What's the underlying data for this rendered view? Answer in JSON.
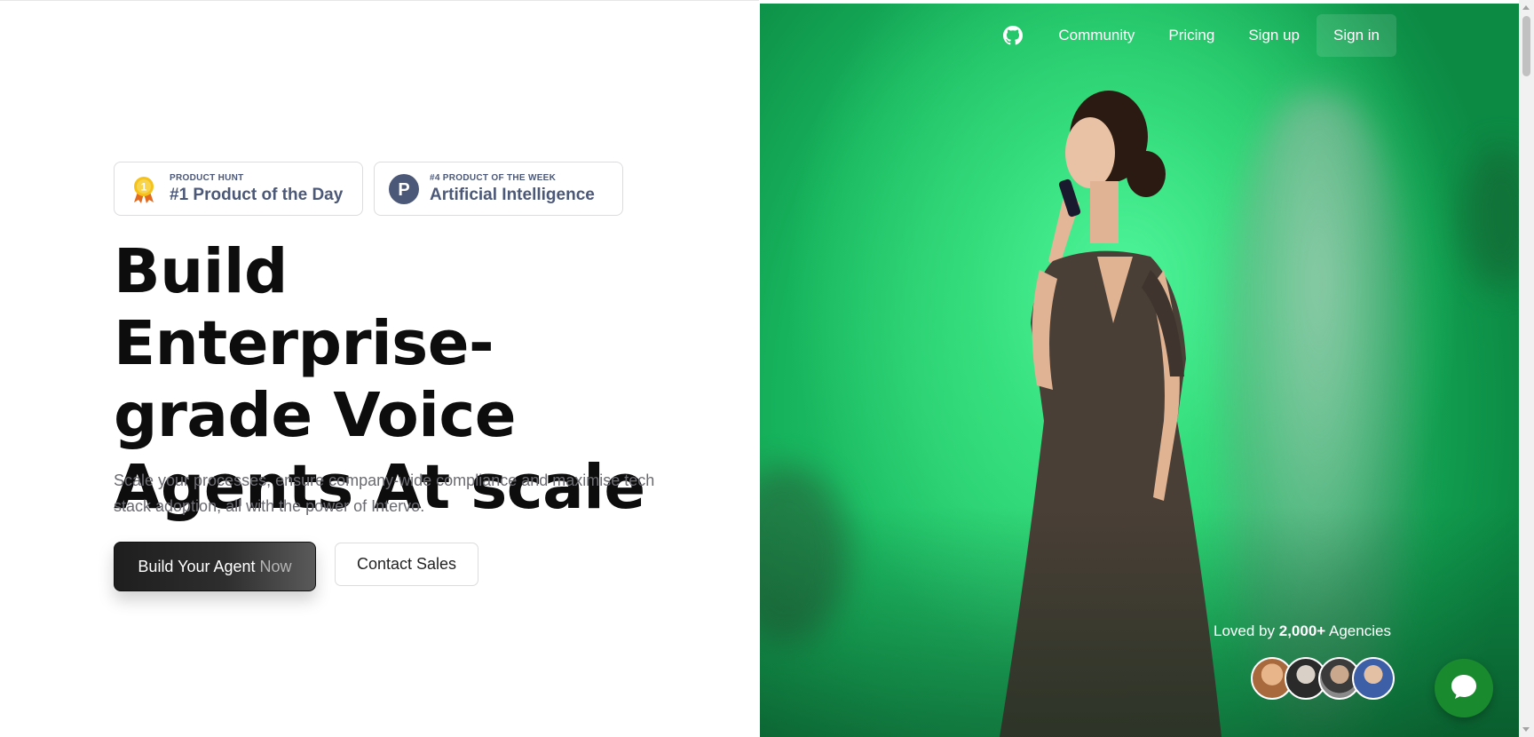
{
  "badges": [
    {
      "small": "PRODUCT HUNT",
      "big": "#1 Product of the Day",
      "icon": "medal-icon"
    },
    {
      "small": "#4 PRODUCT OF THE WEEK",
      "big": "Artificial Intelligence",
      "icon": "product-hunt-icon",
      "icon_letter": "P"
    }
  ],
  "hero": {
    "headline": "Build Enterprise-grade Voice Agents At scale",
    "subtext": "Scale your processes, ensure company-wide compliance and maximise tech stack adoption, all with the power of Intervo.",
    "cta_primary": "Build Your Agent",
    "cta_primary_suffix": "Now",
    "cta_secondary": "Contact Sales"
  },
  "nav": {
    "icon": "github-icon",
    "links": [
      "Community",
      "Pricing",
      "Sign up",
      "Sign in"
    ]
  },
  "social_proof": {
    "prefix": "Loved by",
    "count": "2,000+",
    "suffix": "Agencies"
  },
  "colors": {
    "hero_green": "#2fd879",
    "chat_green": "#1a8a2e",
    "badge_text": "#4c5878"
  }
}
